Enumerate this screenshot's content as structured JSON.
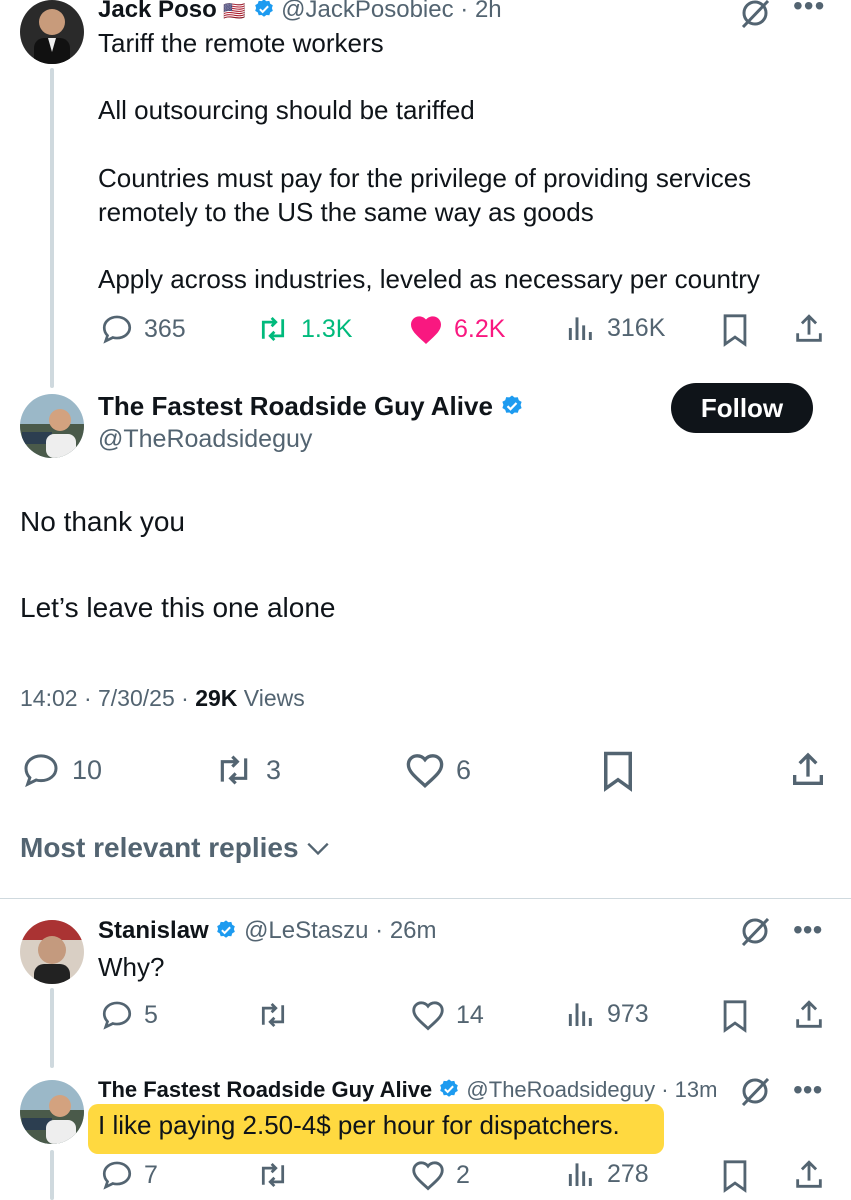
{
  "tweet1": {
    "author": "Jack Poso",
    "flag": "🇺🇸",
    "handle_time": "@JackPosobiec · 2h",
    "lines": [
      "Tariff the remote workers",
      "All outsourcing should be tariffed",
      "Countries must pay for the privilege of providing services",
      "remotely to the US the same way as goods",
      "Apply across industries, leveled as necessary per country"
    ],
    "replies": "365",
    "reposts": "1.3K",
    "likes": "6.2K",
    "views": "316K"
  },
  "main": {
    "author": "The Fastest Roadside Guy Alive",
    "handle": "@TheRoadsideguy",
    "follow_label": "Follow",
    "line1": "No thank you",
    "line2": "Let’s leave this one alone",
    "time": "14:02 · 7/30/25 · ",
    "views_count": "29K",
    "views_label": " Views",
    "replies": "10",
    "reposts": "3",
    "likes": "6"
  },
  "replies_header": "Most relevant replies",
  "reply1": {
    "author": "Stanislaw",
    "handle_time": "@LeStaszu · 26m",
    "text": "Why?",
    "replies": "5",
    "likes": "14",
    "views": "973"
  },
  "reply2": {
    "author": "The Fastest Roadside Guy Alive",
    "handle_time": "@TheRoadsideguy · 13m",
    "text": "I like paying 2.50-4$ per hour for dispatchers.",
    "replies": "7",
    "likes": "2",
    "views": "278"
  },
  "colors": {
    "accent_green": "#00ba7c",
    "accent_pink": "#f91880",
    "verified_blue": "#1d9bf0",
    "highlight": "#ffd21f"
  }
}
